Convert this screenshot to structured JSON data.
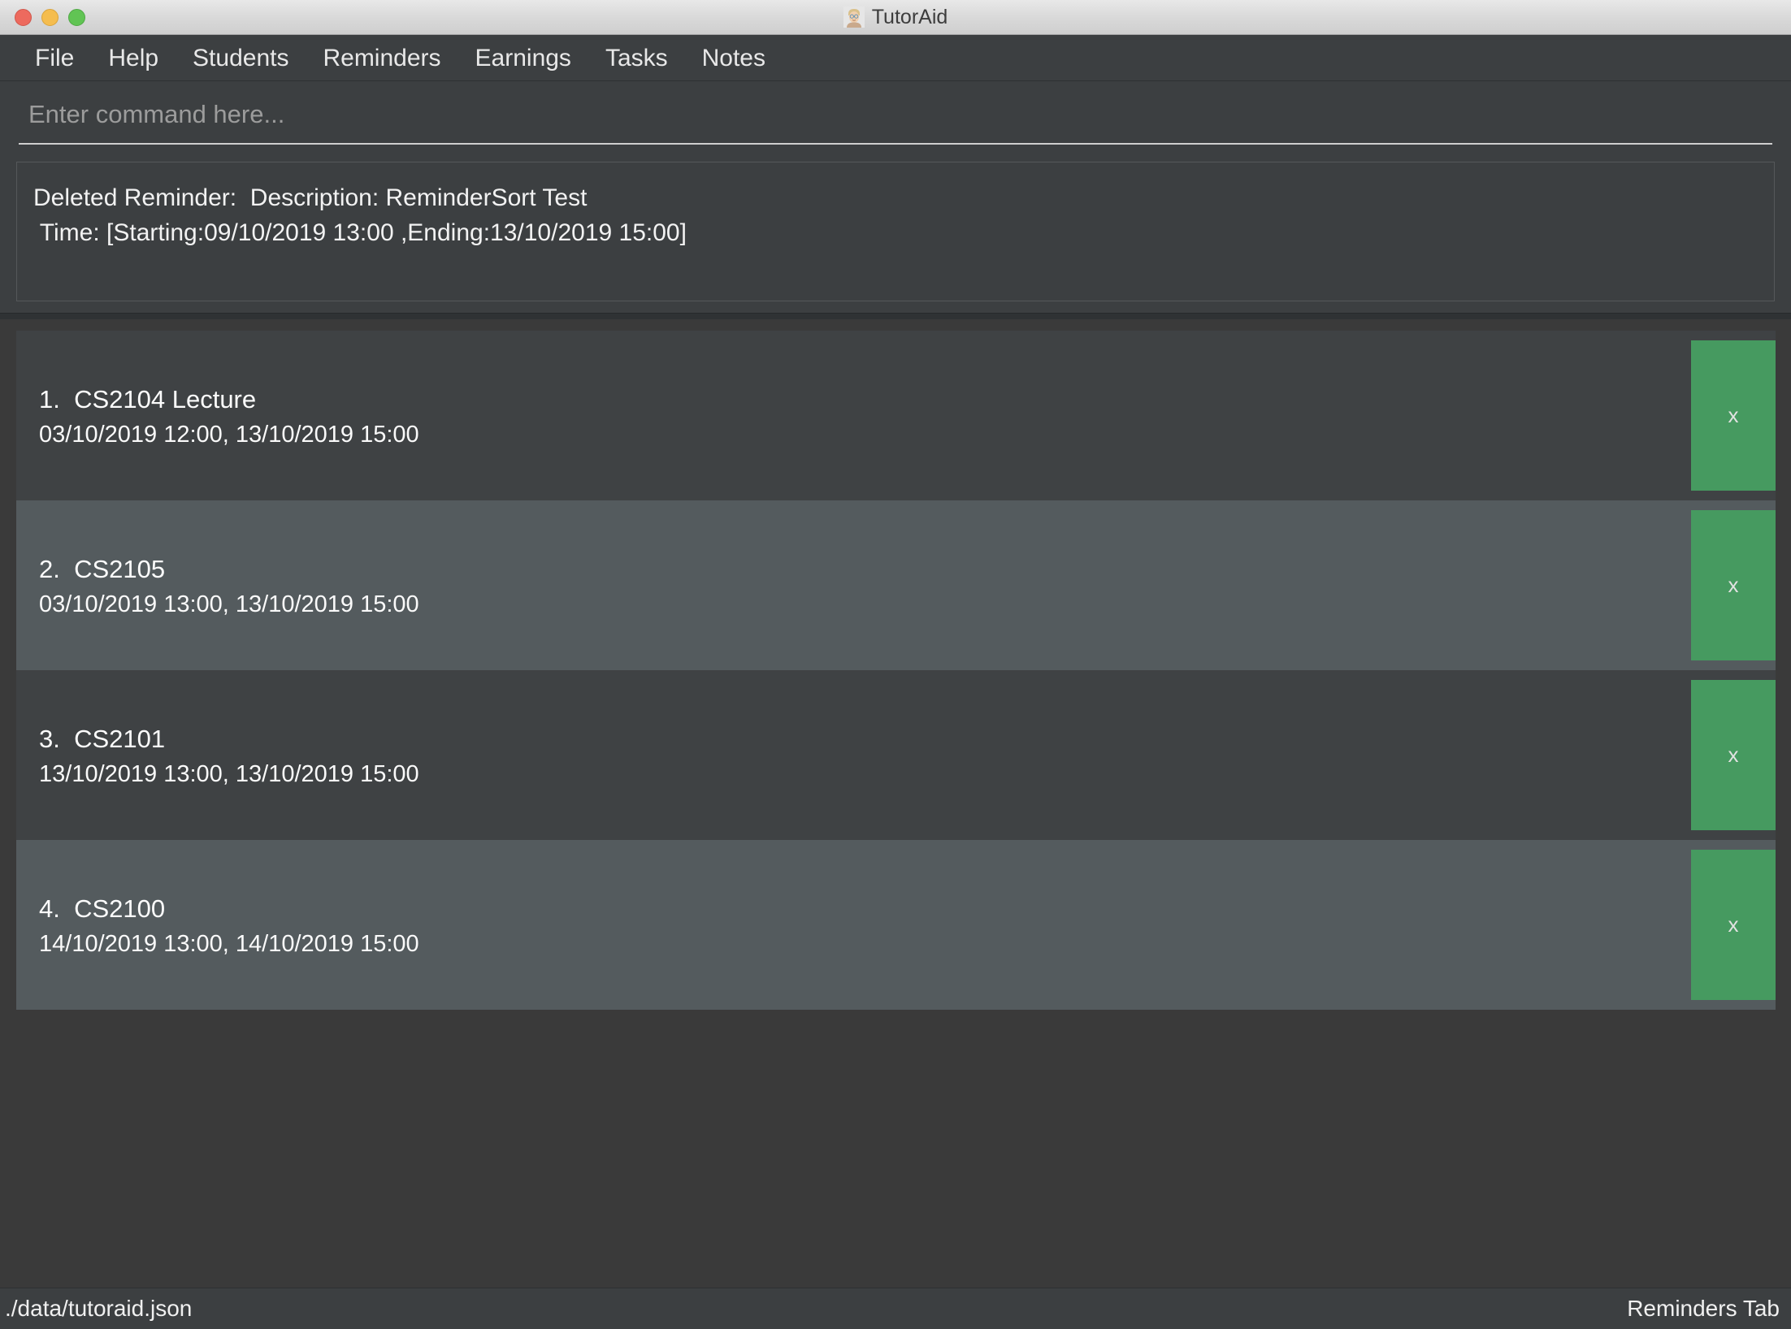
{
  "window": {
    "title": "TutorAid",
    "app_icon": "tutor-avatar-icon",
    "controls": {
      "close": "close-window-button",
      "minimize": "minimize-window-button",
      "maximize": "maximize-window-button"
    }
  },
  "menubar": {
    "items": [
      {
        "label": "File"
      },
      {
        "label": "Help"
      },
      {
        "label": "Students"
      },
      {
        "label": "Reminders"
      },
      {
        "label": "Earnings"
      },
      {
        "label": "Tasks"
      },
      {
        "label": "Notes"
      }
    ]
  },
  "command": {
    "placeholder": "Enter command here...",
    "value": ""
  },
  "result": {
    "lines": [
      "Deleted Reminder:  Description: ReminderSort Test",
      " Time: [Starting:09/10/2019 13:00 ,Ending:13/10/2019 15:00]"
    ]
  },
  "reminders": {
    "delete_label": "x",
    "items": [
      {
        "index": "1.",
        "name": "CS2104 Lecture",
        "title": "1.  CS2104 Lecture",
        "time": "03/10/2019 12:00, 13/10/2019 15:00",
        "start": "03/10/2019 12:00",
        "end": "13/10/2019 15:00"
      },
      {
        "index": "2.",
        "name": "CS2105",
        "title": "2.  CS2105",
        "time": "03/10/2019 13:00, 13/10/2019 15:00",
        "start": "03/10/2019 13:00",
        "end": "13/10/2019 15:00"
      },
      {
        "index": "3.",
        "name": "CS2101",
        "title": "3.  CS2101",
        "time": "13/10/2019 13:00, 13/10/2019 15:00",
        "start": "13/10/2019 13:00",
        "end": "13/10/2019 15:00"
      },
      {
        "index": "4.",
        "name": "CS2100",
        "title": "4.  CS2100",
        "time": "14/10/2019 13:00, 14/10/2019 15:00",
        "start": "14/10/2019 13:00",
        "end": "14/10/2019 15:00"
      }
    ]
  },
  "statusbar": {
    "save_location": "./data/tutoraid.json",
    "active_tab": "Reminders Tab"
  },
  "colors": {
    "accent_green": "#469a60",
    "window_chrome": "#3c3f41",
    "list_row_odd": "#3f4244",
    "list_row_even": "#545b5e",
    "traffic_close": "#ed6a5e",
    "traffic_min": "#f5bd4f",
    "traffic_max": "#61c454"
  }
}
